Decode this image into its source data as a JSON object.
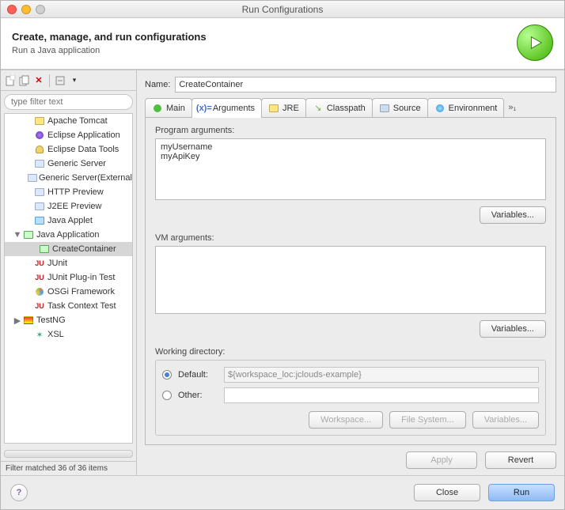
{
  "window": {
    "title": "Run Configurations"
  },
  "header": {
    "title": "Create, manage, and run configurations",
    "subtitle": "Run a Java application"
  },
  "sidebar": {
    "filter_placeholder": "type filter text",
    "items": [
      {
        "label": "Apache Tomcat",
        "icon": "server-yellow"
      },
      {
        "label": "Eclipse Application",
        "icon": "eclipse"
      },
      {
        "label": "Eclipse Data Tools",
        "icon": "db"
      },
      {
        "label": "Generic Server",
        "icon": "server"
      },
      {
        "label": "Generic Server(External",
        "icon": "server"
      },
      {
        "label": "HTTP Preview",
        "icon": "server"
      },
      {
        "label": "J2EE Preview",
        "icon": "server"
      },
      {
        "label": "Java Applet",
        "icon": "applet"
      },
      {
        "label": "Java Application",
        "icon": "java-app",
        "expanded": true,
        "children": [
          {
            "label": "CreateContainer",
            "icon": "java-run",
            "selected": true
          }
        ]
      },
      {
        "label": "JUnit",
        "icon": "junit"
      },
      {
        "label": "JUnit Plug-in Test",
        "icon": "junit-plug"
      },
      {
        "label": "OSGi Framework",
        "icon": "osgi"
      },
      {
        "label": "Task Context Test",
        "icon": "task"
      },
      {
        "label": "TestNG",
        "icon": "testng",
        "expandable": true
      },
      {
        "label": "XSL",
        "icon": "xsl"
      }
    ],
    "status": "Filter matched 36 of 36 items"
  },
  "form": {
    "name_label": "Name:",
    "name_value": "CreateContainer",
    "tabs": [
      {
        "label": "Main",
        "icon": "run-green"
      },
      {
        "label": "Arguments",
        "icon": "args",
        "active": true
      },
      {
        "label": "JRE",
        "icon": "jre"
      },
      {
        "label": "Classpath",
        "icon": "classpath"
      },
      {
        "label": "Source",
        "icon": "source"
      },
      {
        "label": "Environment",
        "icon": "env"
      }
    ],
    "overflow": "»₁",
    "program_args_label": "Program arguments:",
    "program_args_value": "myUsername\nmyApiKey",
    "vm_args_label": "VM arguments:",
    "vm_args_value": "",
    "variables_btn": "Variables...",
    "working_dir_label": "Working directory:",
    "wd_default_label": "Default:",
    "wd_default_value": "${workspace_loc:jclouds-example}",
    "wd_other_label": "Other:",
    "wd_buttons": {
      "workspace": "Workspace...",
      "filesystem": "File System...",
      "variables": "Variables..."
    },
    "apply": "Apply",
    "revert": "Revert"
  },
  "footer": {
    "close": "Close",
    "run": "Run"
  }
}
